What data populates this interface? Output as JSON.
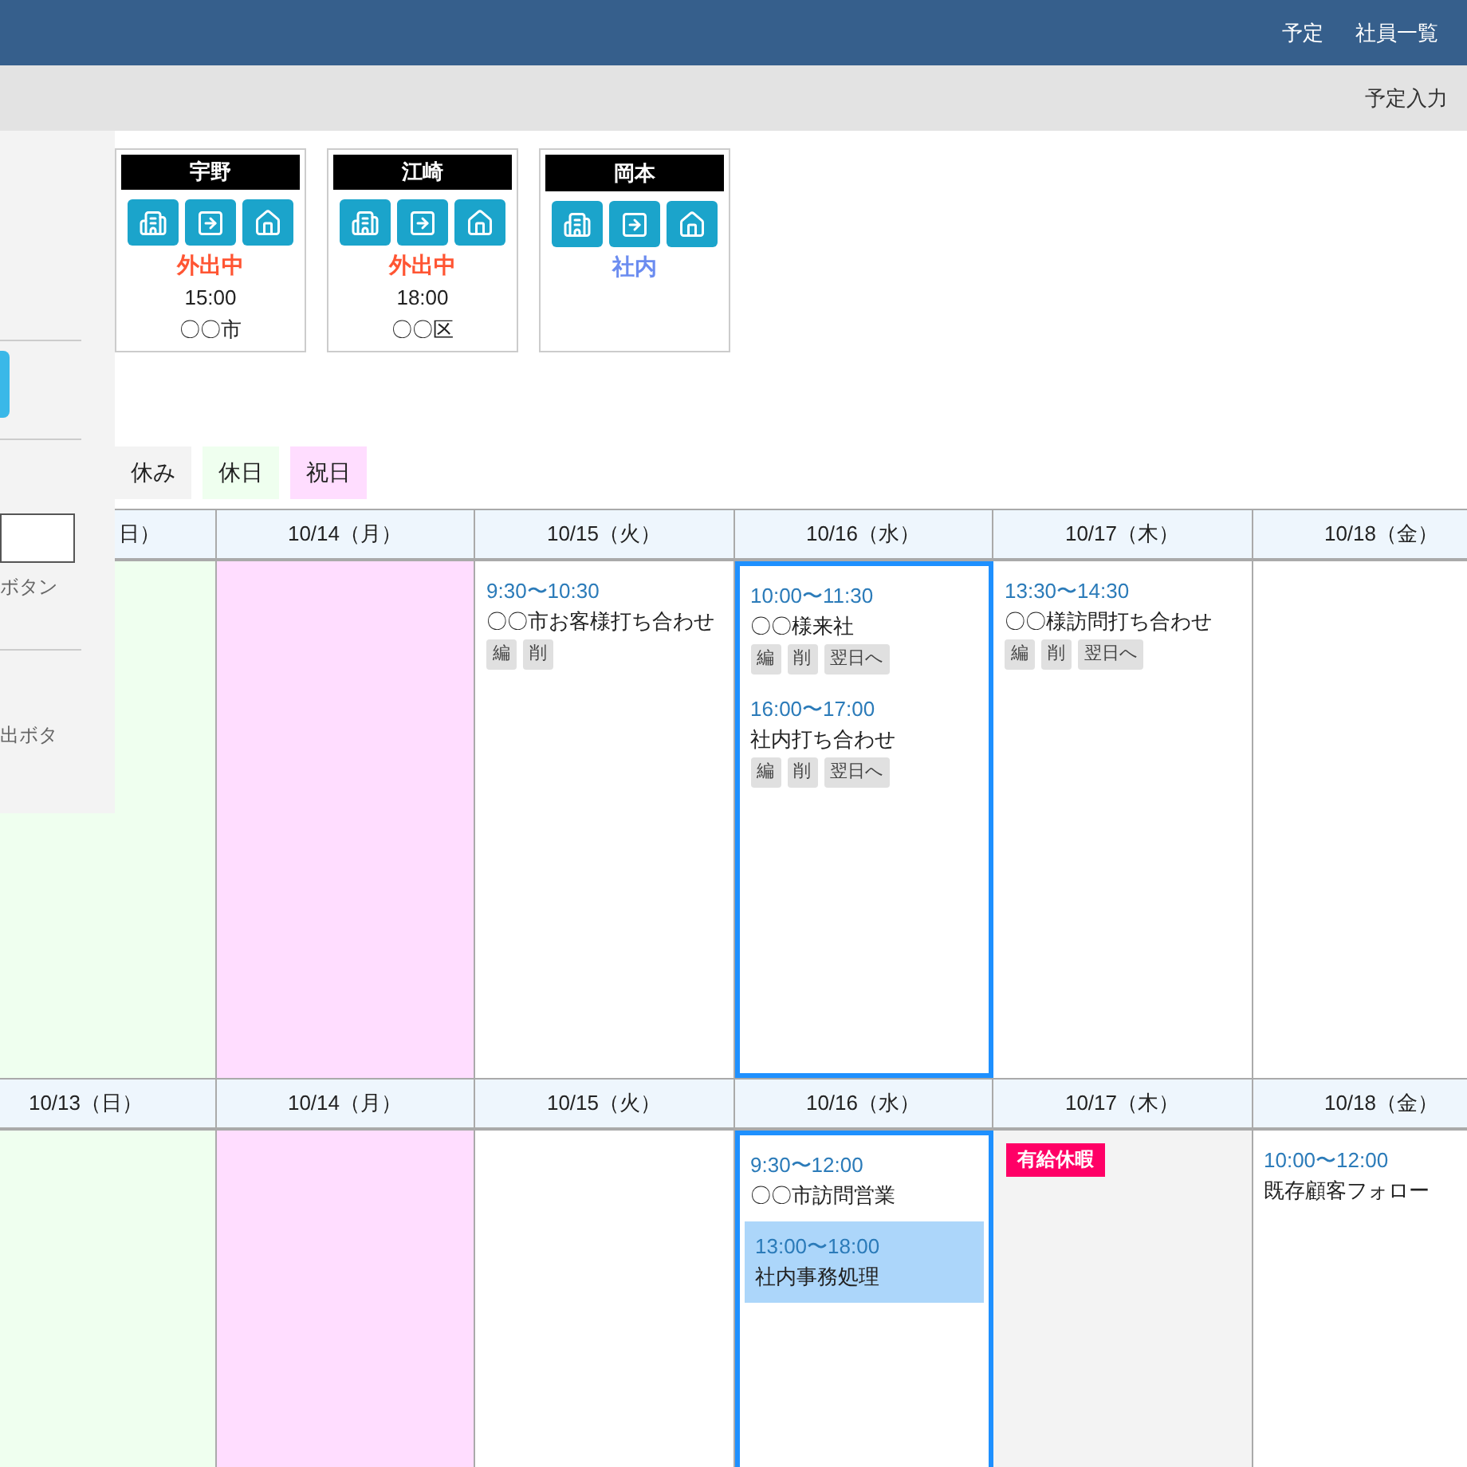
{
  "header": {
    "nav": [
      {
        "label": "予定"
      },
      {
        "label": "社員一覧"
      }
    ]
  },
  "toolbar": {
    "action": "予定入力"
  },
  "side_panel": {
    "first_note": "ボタン",
    "second_note": "出ボタ"
  },
  "employees": [
    {
      "name": "宇野",
      "status": "外出中",
      "color": "#ff5533",
      "time": "15:00",
      "place": "〇〇市"
    },
    {
      "name": "江崎",
      "status": "外出中",
      "color": "#ff5533",
      "time": "18:00",
      "place": "〇〇区"
    },
    {
      "name": "岡本",
      "status": "社内",
      "color": "#6b8cf0"
    }
  ],
  "legend": [
    {
      "label": "休み",
      "kind": "leave"
    },
    {
      "label": "休日",
      "kind": "sunday"
    },
    {
      "label": "祝日",
      "kind": "holiday"
    }
  ],
  "weeks": [
    {
      "days": [
        {
          "label": "日）",
          "kind": "sunday",
          "cut": true,
          "today": false
        },
        {
          "label": "10/14（月）",
          "kind": "holiday",
          "today": false
        },
        {
          "label": "10/15（火）",
          "kind": "weekday",
          "today": false,
          "events": [
            {
              "time": "9:30〜10:30",
              "title": "〇〇市お客様打ち合わせ",
              "highlighted": false,
              "actions": [
                "編",
                "削"
              ]
            }
          ]
        },
        {
          "label": "10/16（水）",
          "kind": "weekday",
          "today": true,
          "events": [
            {
              "time": "10:00〜11:30",
              "title": "〇〇様来社",
              "highlighted": false,
              "actions": [
                "編",
                "削",
                "翌日へ"
              ]
            },
            {
              "time": "16:00〜17:00",
              "title": "社内打ち合わせ",
              "highlighted": false,
              "actions": [
                "編",
                "削",
                "翌日へ"
              ]
            }
          ]
        },
        {
          "label": "10/17（木）",
          "kind": "weekday",
          "today": false,
          "events": [
            {
              "time": "13:30〜14:30",
              "title": "〇〇様訪問打ち合わせ",
              "highlighted": false,
              "actions": [
                "編",
                "削",
                "翌日へ"
              ]
            }
          ]
        },
        {
          "label": "10/18（金）",
          "kind": "weekday",
          "today": false
        }
      ]
    },
    {
      "days": [
        {
          "label": "10/13（日）",
          "kind": "sunday",
          "today": false
        },
        {
          "label": "10/14（月）",
          "kind": "holiday",
          "today": false
        },
        {
          "label": "10/15（火）",
          "kind": "weekday",
          "today": false
        },
        {
          "label": "10/16（水）",
          "kind": "weekday",
          "today": true,
          "events": [
            {
              "time": "9:30〜12:00",
              "title": "〇〇市訪問営業",
              "highlighted": false
            },
            {
              "time": "13:00〜18:00",
              "title": "社内事務処理",
              "highlighted": true
            }
          ]
        },
        {
          "label": "10/17（木）",
          "kind": "leave",
          "today": false,
          "badge": "有給休暇"
        },
        {
          "label": "10/18（金）",
          "kind": "weekday",
          "today": false,
          "events": [
            {
              "time": "10:00〜12:00",
              "title": "既存顧客フォロー",
              "highlighted": false
            }
          ]
        }
      ]
    }
  ]
}
